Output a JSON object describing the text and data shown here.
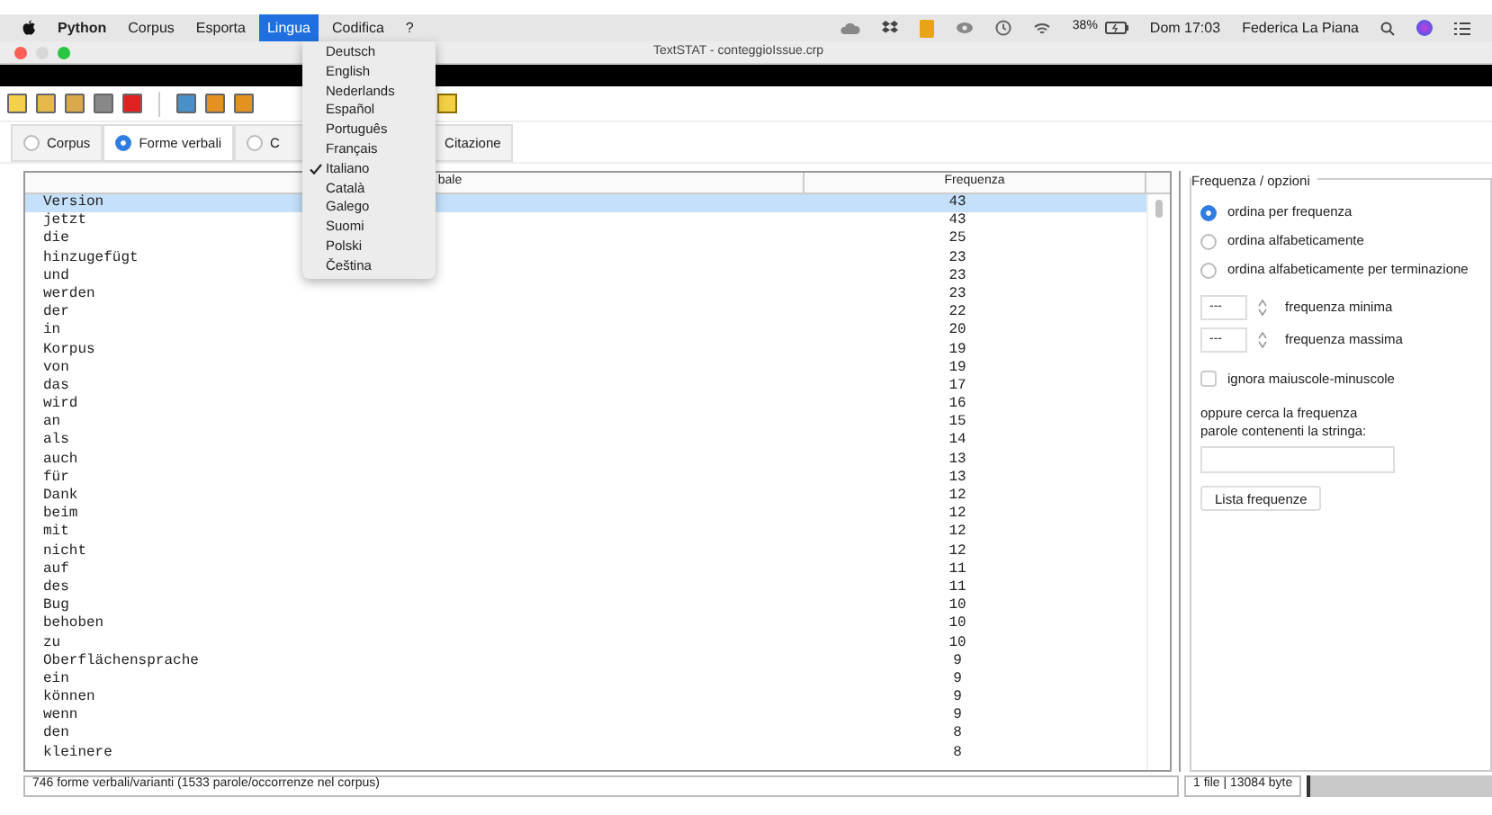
{
  "menubar": {
    "app": "Python",
    "items": [
      {
        "label": "Corpus",
        "selected": false
      },
      {
        "label": "Esporta",
        "selected": false
      },
      {
        "label": "Lingua",
        "selected": true
      },
      {
        "label": "Codifica",
        "selected": false
      },
      {
        "label": "?",
        "selected": false
      }
    ],
    "battery": "38%",
    "clock": "Dom 17:03",
    "user": "Federica La Piana"
  },
  "window": {
    "title": "TextSTAT - conteggioIssue.crp"
  },
  "language_menu": [
    {
      "label": "Deutsch",
      "checked": false
    },
    {
      "label": "English",
      "checked": false
    },
    {
      "label": "Nederlands",
      "checked": false
    },
    {
      "label": "Español",
      "checked": false
    },
    {
      "label": "Português",
      "checked": false
    },
    {
      "label": "Français",
      "checked": false
    },
    {
      "label": "Italiano",
      "checked": true
    },
    {
      "label": "Català",
      "checked": false
    },
    {
      "label": "Galego",
      "checked": false
    },
    {
      "label": "Suomi",
      "checked": false
    },
    {
      "label": "Polski",
      "checked": false
    },
    {
      "label": "Čeština",
      "checked": false
    }
  ],
  "tabs": [
    {
      "label": "Corpus",
      "selected": false
    },
    {
      "label": "Forme verbali",
      "selected": true
    },
    {
      "label": "C",
      "selected": false
    },
    {
      "label": "Citazione",
      "selected": false
    }
  ],
  "table": {
    "columns": [
      "bale",
      "Frequenza"
    ],
    "rows": [
      {
        "cells": [
          "Version",
          "43"
        ],
        "selected": true
      },
      {
        "cells": [
          "jetzt",
          "43"
        ],
        "selected": false
      },
      {
        "cells": [
          "die",
          "25"
        ],
        "selected": false
      },
      {
        "cells": [
          "hinzugefügt",
          "23"
        ],
        "selected": false
      },
      {
        "cells": [
          "und",
          "23"
        ],
        "selected": false
      },
      {
        "cells": [
          "werden",
          "23"
        ],
        "selected": false
      },
      {
        "cells": [
          "der",
          "22"
        ],
        "selected": false
      },
      {
        "cells": [
          "in",
          "20"
        ],
        "selected": false
      },
      {
        "cells": [
          "Korpus",
          "19"
        ],
        "selected": false
      },
      {
        "cells": [
          "von",
          "19"
        ],
        "selected": false
      },
      {
        "cells": [
          "das",
          "17"
        ],
        "selected": false
      },
      {
        "cells": [
          "wird",
          "16"
        ],
        "selected": false
      },
      {
        "cells": [
          "an",
          "15"
        ],
        "selected": false
      },
      {
        "cells": [
          "als",
          "14"
        ],
        "selected": false
      },
      {
        "cells": [
          "auch",
          "13"
        ],
        "selected": false
      },
      {
        "cells": [
          "für",
          "13"
        ],
        "selected": false
      },
      {
        "cells": [
          "Dank",
          "12"
        ],
        "selected": false
      },
      {
        "cells": [
          "beim",
          "12"
        ],
        "selected": false
      },
      {
        "cells": [
          "mit",
          "12"
        ],
        "selected": false
      },
      {
        "cells": [
          "nicht",
          "12"
        ],
        "selected": false
      },
      {
        "cells": [
          "auf",
          "11"
        ],
        "selected": false
      },
      {
        "cells": [
          "des",
          "11"
        ],
        "selected": false
      },
      {
        "cells": [
          "Bug",
          "10"
        ],
        "selected": false
      },
      {
        "cells": [
          "behoben",
          "10"
        ],
        "selected": false
      },
      {
        "cells": [
          "zu",
          "10"
        ],
        "selected": false
      },
      {
        "cells": [
          "Oberflächensprache",
          "9"
        ],
        "selected": false
      },
      {
        "cells": [
          "ein",
          "9"
        ],
        "selected": false
      },
      {
        "cells": [
          "können",
          "9"
        ],
        "selected": false
      },
      {
        "cells": [
          "wenn",
          "9"
        ],
        "selected": false
      },
      {
        "cells": [
          "den",
          "8"
        ],
        "selected": false
      },
      {
        "cells": [
          "kleinere",
          "8"
        ],
        "selected": false
      }
    ]
  },
  "options": {
    "title": "Frequenza / opzioni",
    "sort": [
      {
        "label": "ordina per frequenza",
        "selected": true
      },
      {
        "label": "ordina alfabeticamente",
        "selected": false
      },
      {
        "label": "ordina alfabeticamente per terminazione",
        "selected": false
      }
    ],
    "min": {
      "value": "---",
      "label": "frequenza minima"
    },
    "max": {
      "value": "---",
      "label": "frequenza massima"
    },
    "ignore_case": {
      "label": "ignora maiuscole-minuscole",
      "checked": false
    },
    "search_label": "oppure cerca la frequenza\nparole contenenti la stringa:",
    "button": "Lista frequenze"
  },
  "status_bar": {
    "left": "746 forme verbali/varianti (1533 parole/occorrenze nel corpus)",
    "right": "1 file | 13084 byte"
  }
}
